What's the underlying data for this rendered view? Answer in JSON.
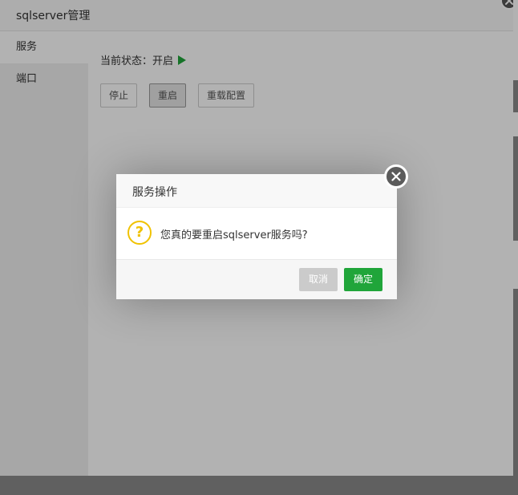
{
  "panel": {
    "title": "sqlserver管理"
  },
  "sidebar": {
    "items": [
      {
        "label": "服务"
      },
      {
        "label": "端口"
      }
    ]
  },
  "service": {
    "status_label": "当前状态：",
    "status_value": "开启",
    "buttons": {
      "stop": "停止",
      "restart": "重启",
      "reload": "重载配置"
    }
  },
  "dialog": {
    "title": "服务操作",
    "message": "您真的要重启sqlserver服务吗?",
    "cancel_label": "取消",
    "confirm_label": "确定"
  },
  "colors": {
    "accent": "#20a53a",
    "question": "#f0c200",
    "overlay": "rgba(0,0,0,0.3)"
  }
}
